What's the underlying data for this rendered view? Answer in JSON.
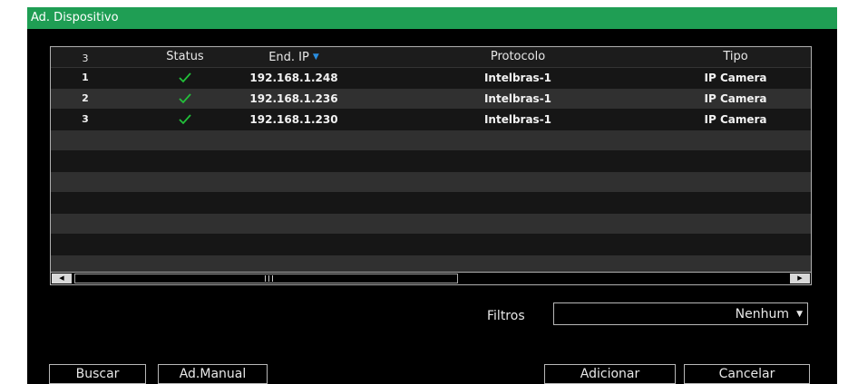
{
  "window": {
    "title": "Ad. Dispositivo"
  },
  "colors": {
    "title_bar": "#1f9e54",
    "background": "#000000",
    "row_alt": "#303030",
    "check": "#22c03a",
    "sort_arrow": "#2a8ee0"
  },
  "table": {
    "count_header": "3",
    "columns": {
      "status": "Status",
      "ip": "End. IP",
      "protocol": "Protocolo",
      "type": "Tipo"
    },
    "sort": {
      "column": "ip",
      "direction": "descending",
      "icon": "sort-down-icon"
    },
    "rows": [
      {
        "index": "1",
        "status": "ok",
        "status_icon": "check-icon",
        "ip": "192.168.1.248",
        "protocol": "Intelbras-1",
        "type": "IP Camera"
      },
      {
        "index": "2",
        "status": "ok",
        "status_icon": "check-icon",
        "ip": "192.168.1.236",
        "protocol": "Intelbras-1",
        "type": "IP Camera"
      },
      {
        "index": "3",
        "status": "ok",
        "status_icon": "check-icon",
        "ip": "192.168.1.230",
        "protocol": "Intelbras-1",
        "type": "IP Camera"
      }
    ],
    "scrollbar": {
      "left_icon": "scroll-left-icon",
      "right_icon": "scroll-right-icon"
    }
  },
  "filter": {
    "label": "Filtros",
    "value": "Nenhum",
    "icon": "dropdown-icon"
  },
  "buttons": {
    "search": "Buscar",
    "manual": "Ad.Manual",
    "add": "Adicionar",
    "cancel": "Cancelar"
  }
}
